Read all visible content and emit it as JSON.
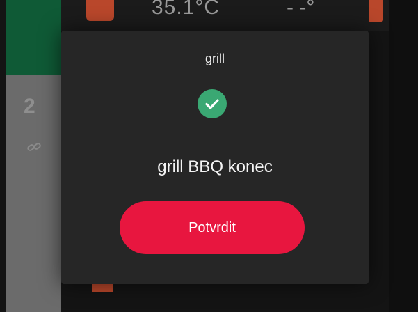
{
  "background": {
    "card_number": "2",
    "temperature": "35.1°C",
    "dash_value": "- -°",
    "link_icon": "link-icon",
    "colors": {
      "green_panel": "#0f5a36",
      "gray_panel": "#6b6b6b",
      "accent": "#b9472b"
    }
  },
  "dialog": {
    "title": "grill",
    "status_icon": "check-circle-icon",
    "message": "grill BBQ konec",
    "confirm_label": "Potvrdit",
    "colors": {
      "surface": "#262626",
      "success": "#3aa873",
      "confirm": "#e8163f"
    }
  }
}
